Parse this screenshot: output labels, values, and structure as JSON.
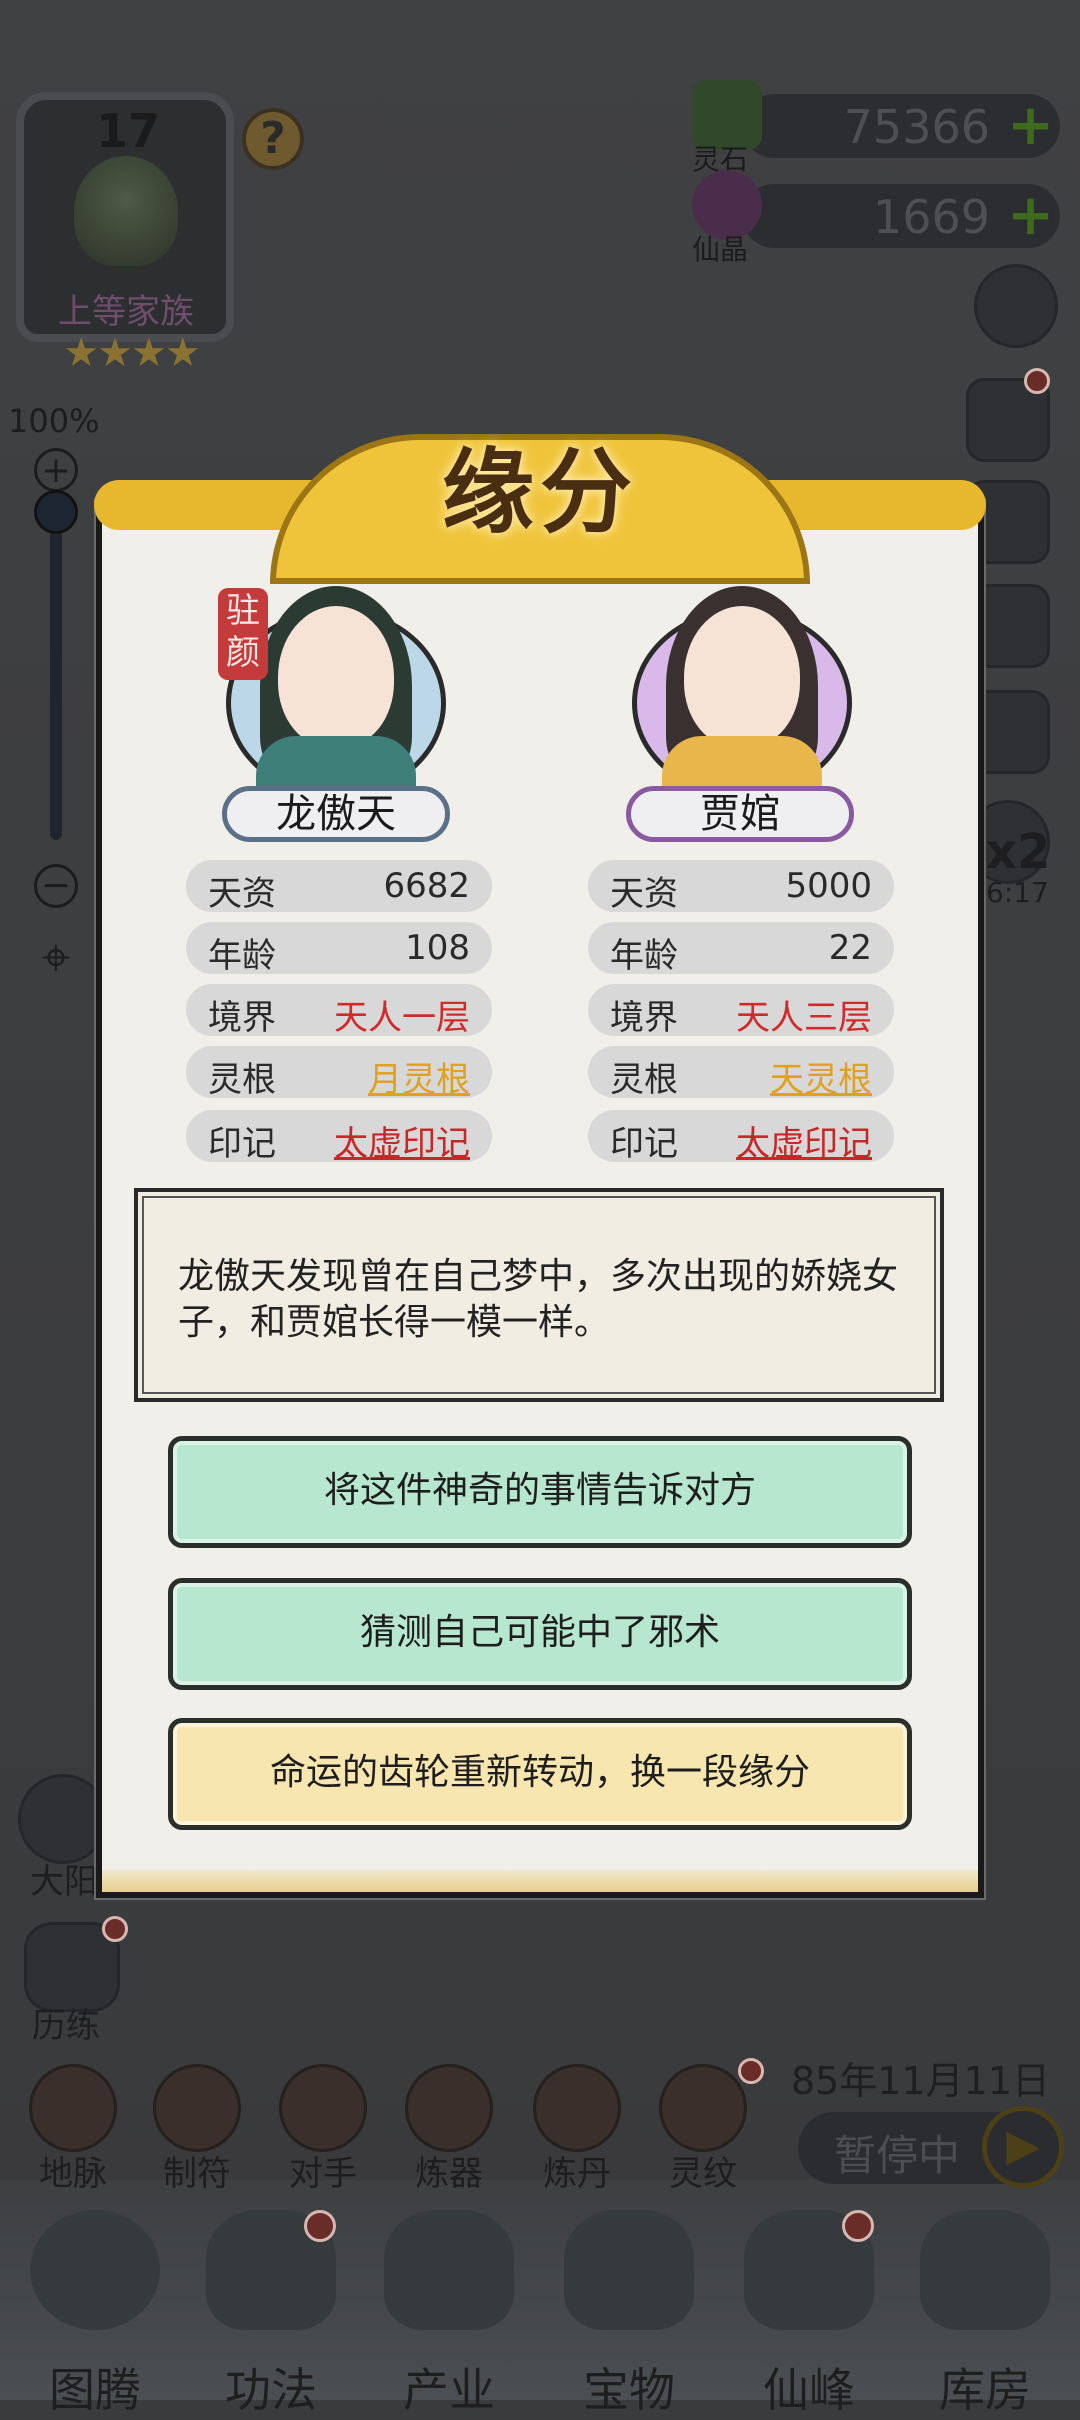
{
  "family": {
    "level": "17",
    "rank": "上等家族",
    "stars": "★★★★"
  },
  "help_label": "?",
  "zoom": {
    "percent": "100%",
    "plus": "+",
    "minus": "−"
  },
  "currency": [
    {
      "label": "灵石",
      "value": "75366",
      "plus": "+"
    },
    {
      "label": "仙晶",
      "value": "1669",
      "plus": "+"
    }
  ],
  "side": {
    "multiplier": "x2",
    "timer": "6:17",
    "left_label1": "大阳",
    "left_label2": "历练"
  },
  "small_buttons": [
    "地脉",
    "制符",
    "对手",
    "炼器",
    "炼丹",
    "灵纹"
  ],
  "game_date": "85年11月11日",
  "pause_label": "暂停中",
  "tabs": [
    "图腾",
    "功法",
    "产业",
    "宝物",
    "仙峰",
    "库房"
  ],
  "dialog": {
    "title": "缘分",
    "left": {
      "seal": "驻颜",
      "name": "龙傲天",
      "stats": [
        {
          "k": "天资",
          "v": "6682"
        },
        {
          "k": "年龄",
          "v": "108"
        },
        {
          "k": "境界",
          "v": "天人一层"
        },
        {
          "k": "灵根",
          "v": "月灵根"
        },
        {
          "k": "印记",
          "v": "太虚印记"
        }
      ]
    },
    "right": {
      "name": "贾婠",
      "stats": [
        {
          "k": "天资",
          "v": "5000"
        },
        {
          "k": "年龄",
          "v": "22"
        },
        {
          "k": "境界",
          "v": "天人三层"
        },
        {
          "k": "灵根",
          "v": "天灵根"
        },
        {
          "k": "印记",
          "v": "太虚印记"
        }
      ]
    },
    "story": "龙傲天发现曾在自己梦中，多次出现的娇娆女子，和贾婠长得一模一样。",
    "choices": [
      "将这件神奇的事情告诉对方",
      "猜测自己可能中了邪术",
      "命运的齿轮重新转动，换一段缘分"
    ]
  },
  "colors": {
    "accent_gold": "#f0c43a",
    "choice_green": "#b7e7cf",
    "choice_gold": "#f8e6b0",
    "realm_red": "#d12a2a",
    "root_gold": "#e0a020"
  }
}
